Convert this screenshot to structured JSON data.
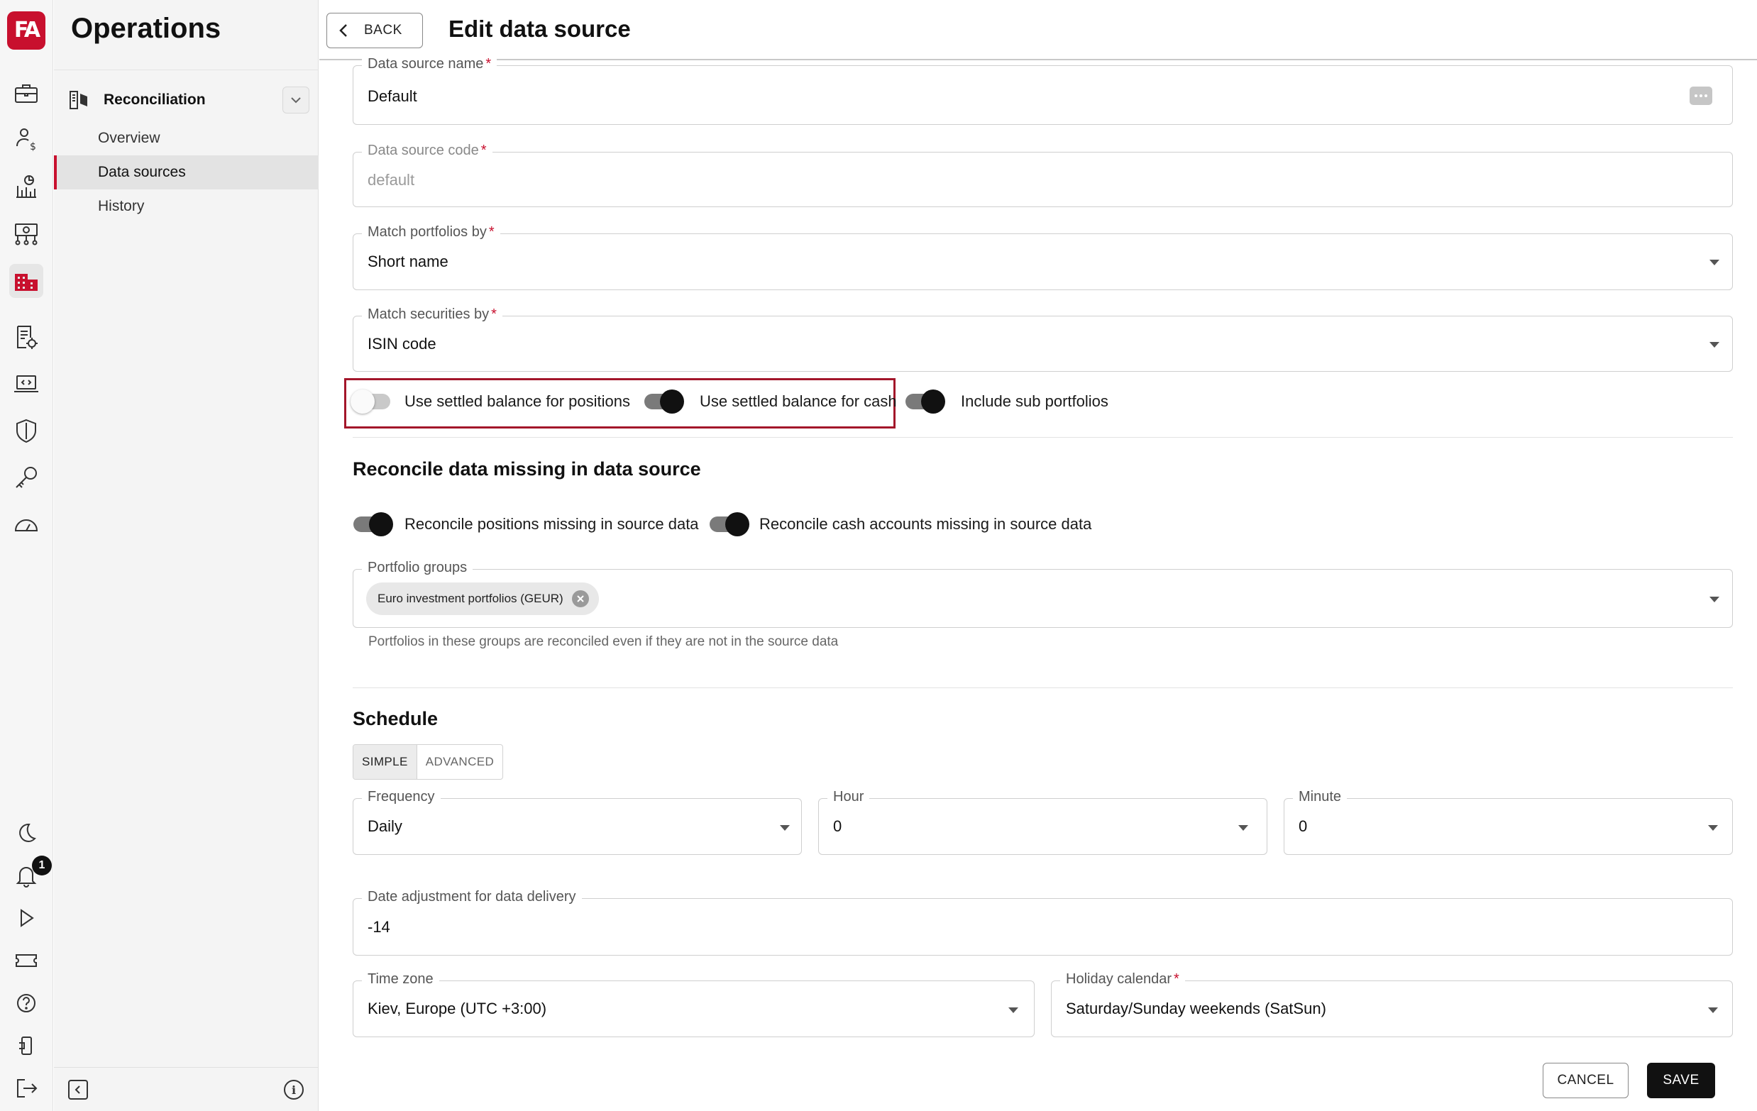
{
  "rail": {
    "logo_text": "FA",
    "notification_count": "1"
  },
  "nav": {
    "app_title": "Operations",
    "section_label": "Reconciliation",
    "items": [
      "Overview",
      "Data sources",
      "History"
    ]
  },
  "header": {
    "back_label": "BACK",
    "title": "Edit data source"
  },
  "form": {
    "data_source_name": {
      "label": "Data source name",
      "value": "Default"
    },
    "data_source_code": {
      "label": "Data source code",
      "value": "default"
    },
    "match_portfolios_by": {
      "label": "Match portfolios by",
      "value": "Short name"
    },
    "match_securities_by": {
      "label": "Match securities by",
      "value": "ISIN code"
    },
    "required_marker": "*",
    "toggles": {
      "settled_positions": {
        "label": "Use settled balance for positions",
        "on": false
      },
      "settled_cash": {
        "label": "Use settled balance for cash",
        "on": true
      },
      "sub_portfolios": {
        "label": "Include sub portfolios",
        "on": true
      }
    }
  },
  "missing_section": {
    "heading": "Reconcile data missing in data source",
    "toggles": {
      "positions_missing": {
        "label": "Reconcile positions missing in source data",
        "on": true
      },
      "cash_missing": {
        "label": "Reconcile cash accounts missing in source data",
        "on": true
      }
    },
    "portfolio_groups": {
      "label": "Portfolio groups",
      "chip": "Euro investment portfolios (GEUR)",
      "helper": "Portfolios in these groups are reconciled even if they are not in the source data"
    }
  },
  "schedule": {
    "heading": "Schedule",
    "modes": [
      "SIMPLE",
      "ADVANCED"
    ],
    "selected_mode": "SIMPLE",
    "frequency": {
      "label": "Frequency",
      "value": "Daily"
    },
    "hour": {
      "label": "Hour",
      "value": "0"
    },
    "minute": {
      "label": "Minute",
      "value": "0"
    },
    "date_adjustment": {
      "label": "Date adjustment for data delivery",
      "value": "-14"
    },
    "time_zone": {
      "label": "Time zone",
      "value": "Kiev, Europe (UTC +3:00)"
    },
    "holiday_calendar": {
      "label": "Holiday calendar",
      "value": "Saturday/Sunday weekends (SatSun)"
    }
  },
  "actions": {
    "cancel_label": "CANCEL",
    "save_label": "SAVE"
  },
  "colors": {
    "brand": "#c8102e",
    "highlight": "#a3162a"
  }
}
